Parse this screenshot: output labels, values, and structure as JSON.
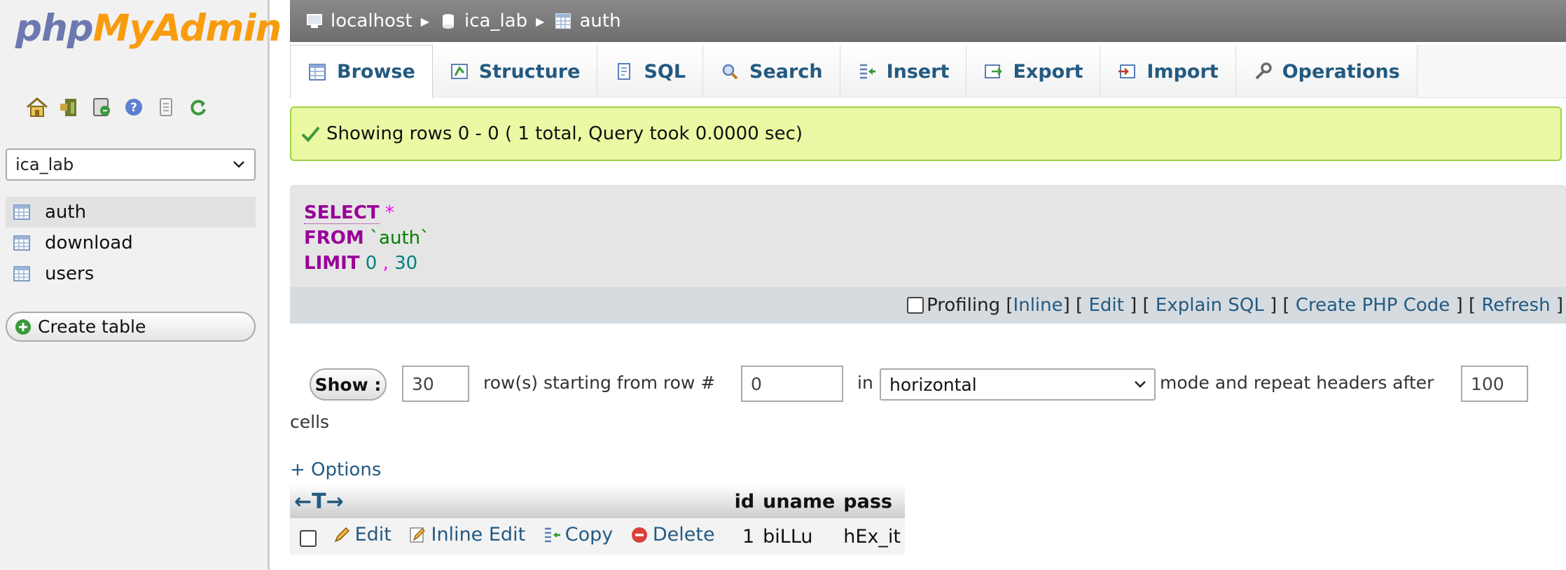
{
  "logo": {
    "part1": "php",
    "part2": "MyAdmin"
  },
  "nav_icons": [
    "home-icon",
    "exit-icon",
    "query-window-icon",
    "help-icon",
    "docs-icon",
    "reload-icon"
  ],
  "db_select": {
    "value": "ica_lab"
  },
  "tree": [
    {
      "label": "auth",
      "active": true
    },
    {
      "label": "download",
      "active": false
    },
    {
      "label": "users",
      "active": false
    }
  ],
  "create_table": "Create table",
  "breadcrumb": {
    "server": "localhost",
    "database": "ica_lab",
    "table": "auth"
  },
  "tabs": [
    {
      "label": "Browse",
      "icon": "browse-icon"
    },
    {
      "label": "Structure",
      "icon": "structure-icon"
    },
    {
      "label": "SQL",
      "icon": "sql-icon"
    },
    {
      "label": "Search",
      "icon": "search-icon"
    },
    {
      "label": "Insert",
      "icon": "insert-icon"
    },
    {
      "label": "Export",
      "icon": "export-icon"
    },
    {
      "label": "Import",
      "icon": "import-icon"
    },
    {
      "label": "Operations",
      "icon": "operations-icon"
    }
  ],
  "notice": "Showing rows 0 - 0 ( 1 total, Query took 0.0000 sec)",
  "sql": {
    "select_kw": "SELECT",
    "star": "*",
    "from_kw": "FROM",
    "table": "`auth`",
    "limit_kw": "LIMIT",
    "limit_start": "0",
    "limit_comma": ",",
    "limit_count": "30"
  },
  "query_links": {
    "profiling": "Profiling",
    "inline": "Inline",
    "edit": "Edit",
    "explain": "Explain SQL",
    "php": "Create PHP Code",
    "refresh": "Refresh"
  },
  "navigation": {
    "show_label": "Show :",
    "rows_value": "30",
    "rows_text": "row(s) starting from row #",
    "start_value": "0",
    "in_text": "in",
    "mode_value": "horizontal",
    "mode_text": "mode and repeat headers after",
    "repeat_value": "100",
    "cells_text": "cells"
  },
  "options_link": "+ Options",
  "table": {
    "columns": [
      "id",
      "uname",
      "pass"
    ],
    "rows": [
      {
        "id": "1",
        "uname": "biLLu",
        "pass": "hEx_it"
      }
    ],
    "actions": {
      "edit": "Edit",
      "inline_edit": "Inline Edit",
      "copy": "Copy",
      "delete": "Delete"
    }
  }
}
